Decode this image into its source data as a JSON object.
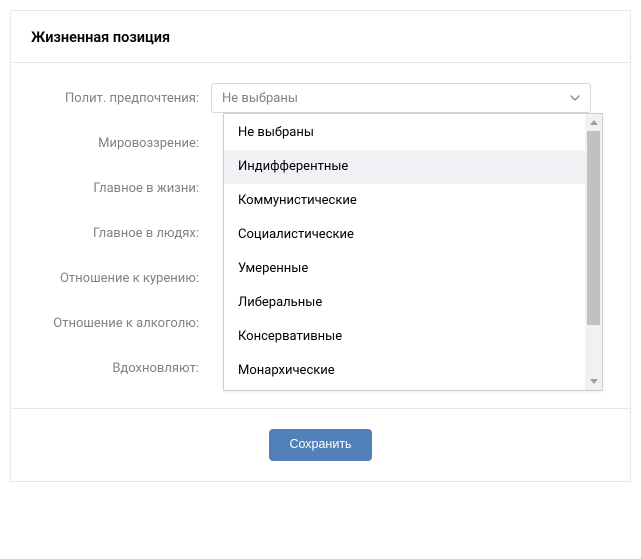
{
  "header": {
    "title": "Жизненная позиция"
  },
  "form": {
    "political_label": "Полит. предпочтения:",
    "political_value": "Не выбраны",
    "worldview_label": "Мировоззрение:",
    "life_main_label": "Главное в жизни:",
    "people_main_label": "Главное в людях:",
    "smoking_label": "Отношение к курению:",
    "alcohol_label": "Отношение к алкоголю:",
    "inspired_label": "Вдохновляют:"
  },
  "dropdown": {
    "highlight_index": 1,
    "options": [
      "Не выбраны",
      "Индифферентные",
      "Коммунистические",
      "Социалистические",
      "Умеренные",
      "Либеральные",
      "Консервативные",
      "Монархические"
    ]
  },
  "footer": {
    "save_label": "Сохранить"
  }
}
